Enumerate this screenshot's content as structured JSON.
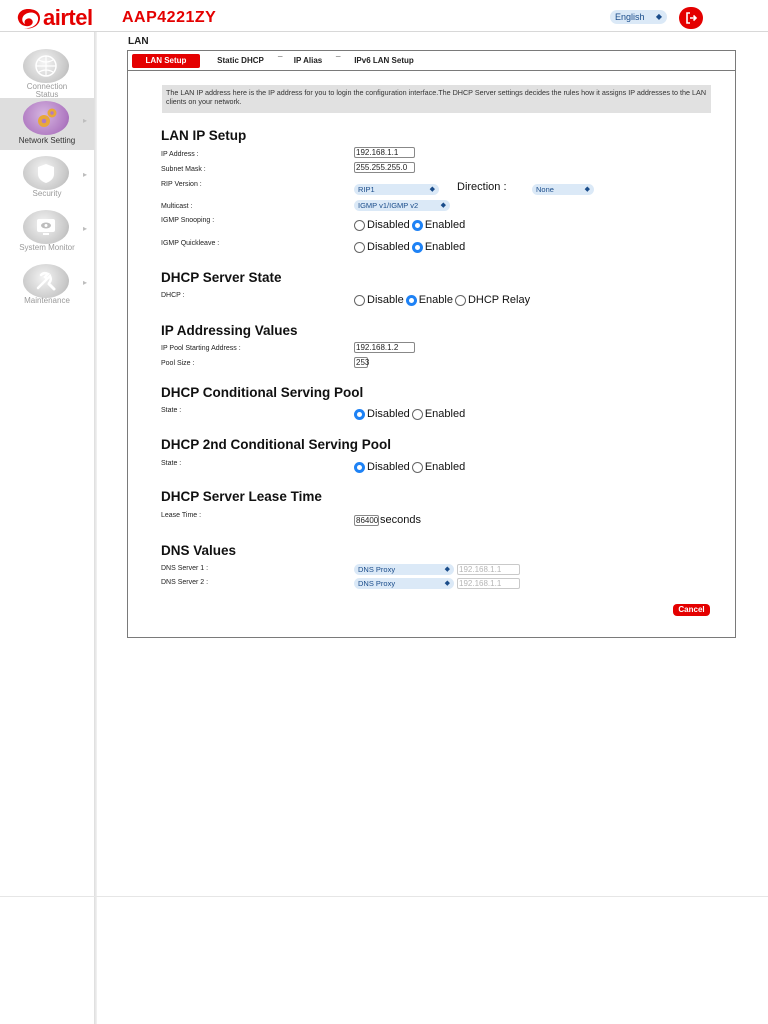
{
  "header": {
    "brand": "airtel",
    "model": "AAP4221ZY",
    "language": "English",
    "colors": {
      "brand_red": "#e40000",
      "select_bg": "#dbe9f7"
    },
    "logout_icon": "logout-icon"
  },
  "sidebar": {
    "items": [
      {
        "label": "Connection Status",
        "icon": "globe-icon",
        "active": false
      },
      {
        "label": "Network Setting",
        "icon": "gears-icon",
        "active": true
      },
      {
        "label": "Security",
        "icon": "shield-icon",
        "active": false
      },
      {
        "label": "System Monitor",
        "icon": "monitor-icon",
        "active": false
      },
      {
        "label": "Maintenance",
        "icon": "tools-icon",
        "active": false
      }
    ]
  },
  "page": {
    "title": "LAN",
    "tabs": [
      "LAN Setup",
      "Static DHCP",
      "IP Alias",
      "IPv6 LAN Setup"
    ],
    "active_tab": "LAN Setup",
    "info": "The LAN IP address here is the IP address for you to login the configuration interface.The DHCP Server settings decides the rules how it assigns IP addresses to the LAN clients on your network."
  },
  "lan_ip_setup": {
    "heading": "LAN IP Setup",
    "ip_label": "IP Address :",
    "ip_value": "192.168.1.1",
    "mask_label": "Subnet Mask :",
    "mask_value": "255.255.255.0",
    "rip_label": "RIP Version :",
    "rip_value": "RIP1",
    "direction_label": "Direction :",
    "direction_value": "None",
    "multicast_label": "Multicast :",
    "multicast_value": "IGMP v1/IGMP v2",
    "igmp_snooping_label": "IGMP Snooping :",
    "igmp_quickleave_label": "IGMP Quickleave :",
    "disabled": "Disabled",
    "enabled": "Enabled"
  },
  "dhcp_state": {
    "heading": "DHCP Server State",
    "label": "DHCP :",
    "opt_disable": "Disable",
    "opt_enable": "Enable",
    "opt_relay": "DHCP Relay"
  },
  "ip_addressing": {
    "heading": "IP Addressing Values",
    "start_label": "IP Pool Starting Address :",
    "start_value": "192.168.1.2",
    "size_label": "Pool Size :",
    "size_value": "253"
  },
  "cond_pool": {
    "heading": "DHCP Conditional Serving Pool",
    "state_label": "State :",
    "disabled": "Disabled",
    "enabled": "Enabled"
  },
  "cond_pool2": {
    "heading": "DHCP 2nd Conditional Serving Pool",
    "state_label": "State :",
    "disabled": "Disabled",
    "enabled": "Enabled"
  },
  "lease": {
    "heading": "DHCP Server Lease Time",
    "label": "Lease Time :",
    "value": "86400",
    "unit": "seconds"
  },
  "dns": {
    "heading": "DNS Values",
    "dns1_label": "DNS Server 1 :",
    "dns1_mode": "DNS Proxy",
    "dns1_value": "192.168.1.1",
    "dns2_label": "DNS Server 2 :",
    "dns2_mode": "DNS Proxy",
    "dns2_value": "192.168.1.1"
  },
  "actions": {
    "cancel": "Cancel"
  }
}
